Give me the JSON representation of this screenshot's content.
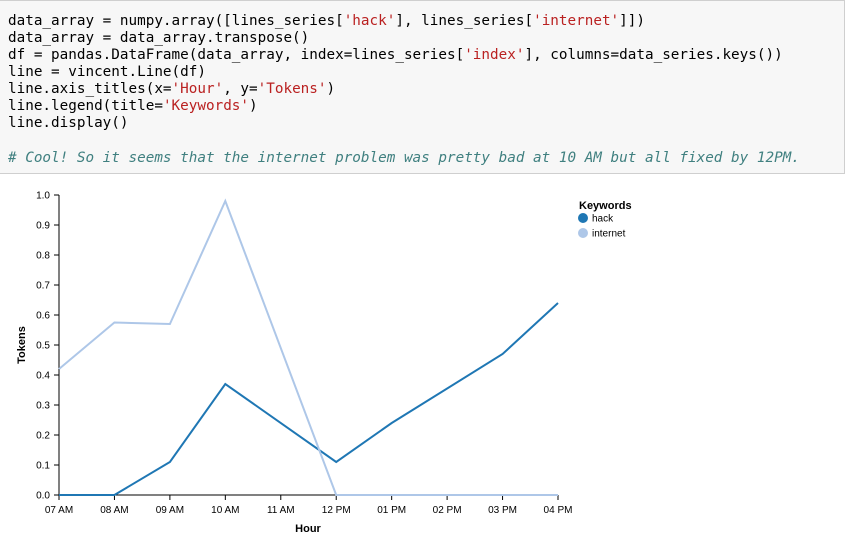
{
  "code": {
    "lines": [
      [
        {
          "t": "data_array = numpy.array([lines_series["
        },
        {
          "t": "'hack'",
          "s": 1
        },
        {
          "t": "], lines_series["
        },
        {
          "t": "'internet'",
          "s": 1
        },
        {
          "t": "]])"
        }
      ],
      [
        {
          "t": "data_array = data_array.transpose()"
        }
      ],
      [
        {
          "t": "df = pandas.DataFrame(data_array, index=lines_series["
        },
        {
          "t": "'index'",
          "s": 1
        },
        {
          "t": "], columns=data_series.keys())"
        }
      ],
      [
        {
          "t": "line = vincent.Line(df)"
        }
      ],
      [
        {
          "t": "line.axis_titles(x="
        },
        {
          "t": "'Hour'",
          "s": 1
        },
        {
          "t": ", y="
        },
        {
          "t": "'Tokens'",
          "s": 1
        },
        {
          "t": ")"
        }
      ],
      [
        {
          "t": "line.legend(title="
        },
        {
          "t": "'Keywords'",
          "s": 1
        },
        {
          "t": ")"
        }
      ],
      [
        {
          "t": "line.display()"
        }
      ]
    ],
    "comment": "# Cool! So it seems that the internet problem was pretty bad at 10 AM but all fixed by 12PM."
  },
  "chart_data": {
    "type": "line",
    "categories": [
      "07 AM",
      "08 AM",
      "09 AM",
      "10 AM",
      "11 AM",
      "12 PM",
      "01 PM",
      "02 PM",
      "03 PM",
      "04 PM"
    ],
    "x_positions": [
      0,
      1,
      2,
      3,
      4,
      5,
      6,
      7,
      8,
      9
    ],
    "series": [
      {
        "name": "hack",
        "color": "#1f77b4",
        "points": [
          [
            0,
            0.0
          ],
          [
            1,
            0.0
          ],
          [
            2,
            0.11
          ],
          [
            3,
            0.37
          ],
          [
            5,
            0.11
          ],
          [
            6,
            0.24
          ],
          [
            8,
            0.47
          ],
          [
            9,
            0.64
          ]
        ]
      },
      {
        "name": "internet",
        "color": "#aec7e8",
        "points": [
          [
            0,
            0.42
          ],
          [
            1,
            0.575
          ],
          [
            2,
            0.57
          ],
          [
            3,
            0.98
          ],
          [
            5,
            0.0
          ],
          [
            9,
            0.0
          ]
        ]
      }
    ],
    "xlabel": "Hour",
    "ylabel": "Tokens",
    "legend_title": "Keywords",
    "legend_position": "top-right",
    "ylim": [
      0,
      1.0
    ],
    "yticks": [
      0.0,
      0.1,
      0.2,
      0.3,
      0.4,
      0.5,
      0.6,
      0.7,
      0.8,
      0.9,
      1.0
    ],
    "ytick_labels": [
      "0.0",
      "0.1",
      "0.2",
      "0.3",
      "0.4",
      "0.5",
      "0.6",
      "0.7",
      "0.8",
      "0.9",
      "1.0"
    ],
    "grid": false
  }
}
